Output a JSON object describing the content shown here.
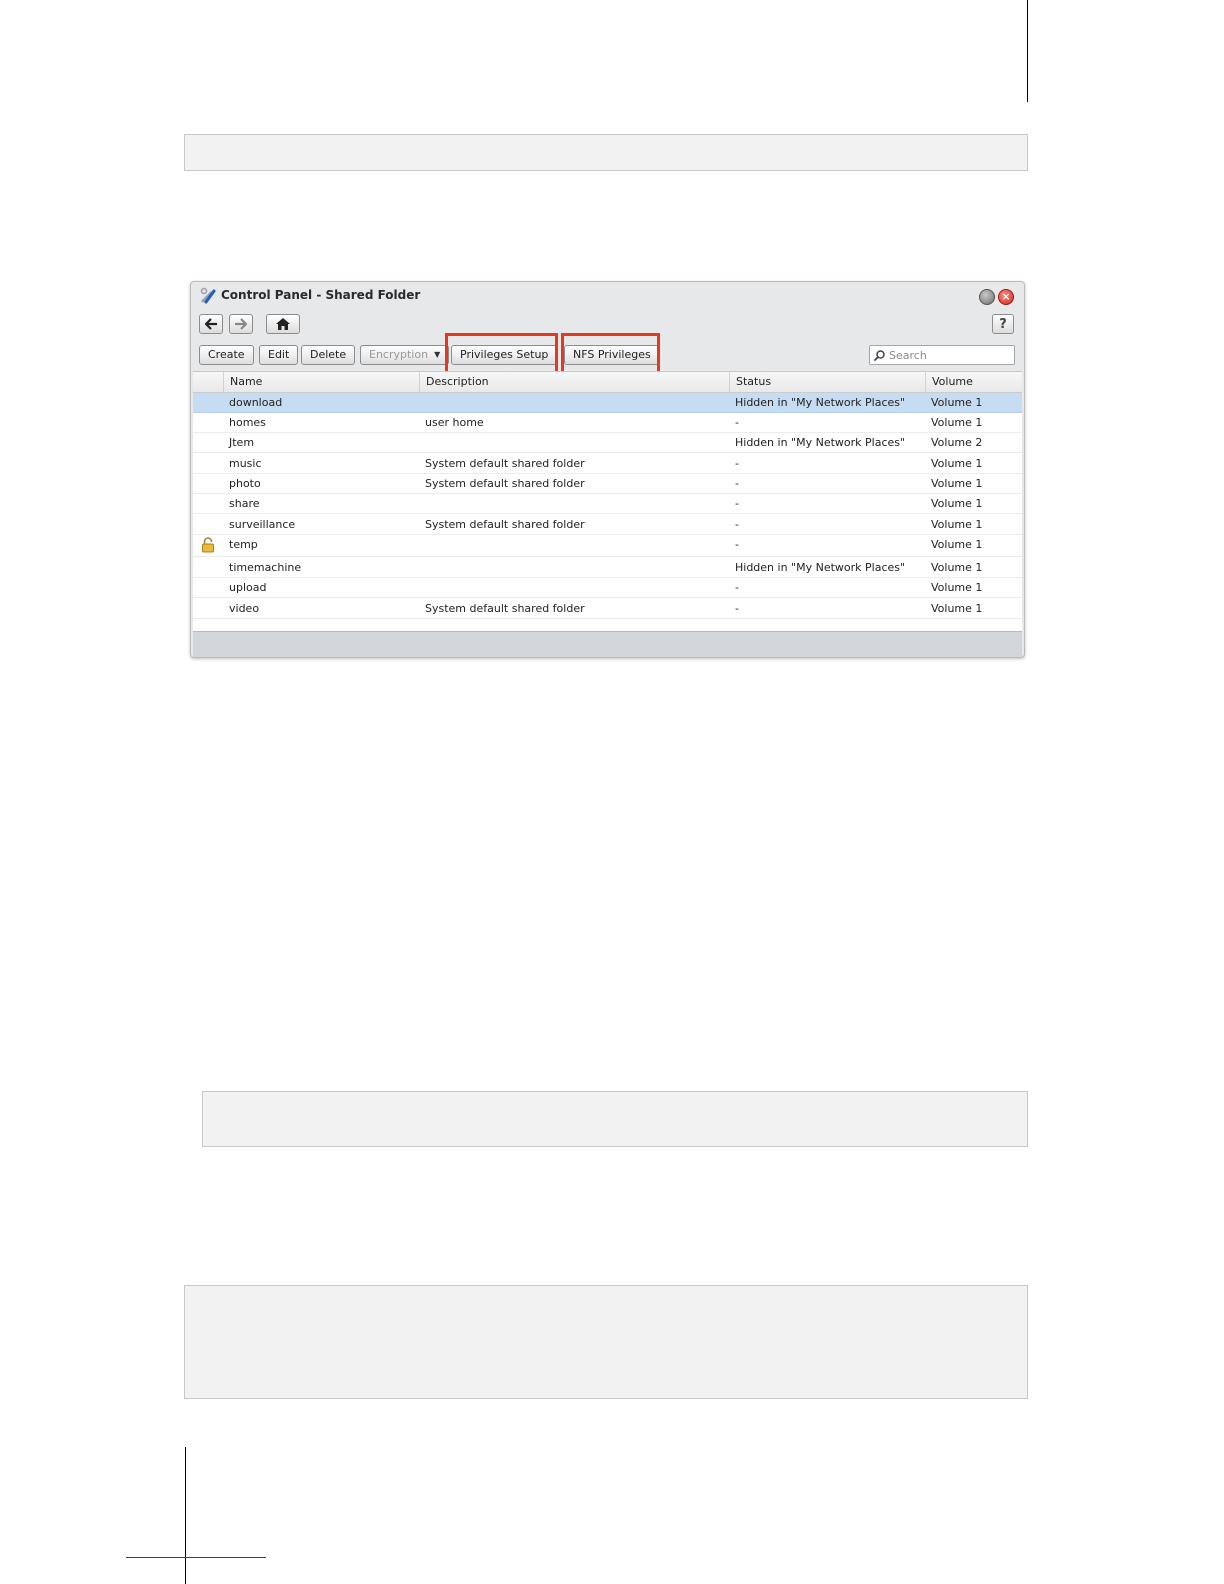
{
  "window": {
    "title": "Control Panel - Shared Folder"
  },
  "toolbar": {
    "create": "Create",
    "edit": "Edit",
    "delete": "Delete",
    "encryption": "Encryption",
    "privileges_setup": "Privileges Setup",
    "nfs_privileges": "NFS Privileges",
    "search_placeholder": "Search"
  },
  "nav": {
    "help": "?"
  },
  "grid": {
    "columns": [
      "Name",
      "Description",
      "Status",
      "Volume"
    ],
    "rows": [
      {
        "name": "download",
        "description": "",
        "status": "Hidden in \"My Network Places\"",
        "volume": "Volume 1",
        "selected": true,
        "locked": false
      },
      {
        "name": "homes",
        "description": "user home",
        "status": "-",
        "volume": "Volume 1",
        "selected": false,
        "locked": false
      },
      {
        "name": "Jtem",
        "description": "",
        "status": "Hidden in \"My Network Places\"",
        "volume": "Volume 2",
        "selected": false,
        "locked": false
      },
      {
        "name": "music",
        "description": "System default shared folder",
        "status": "-",
        "volume": "Volume 1",
        "selected": false,
        "locked": false
      },
      {
        "name": "photo",
        "description": "System default shared folder",
        "status": "-",
        "volume": "Volume 1",
        "selected": false,
        "locked": false
      },
      {
        "name": "share",
        "description": "",
        "status": "-",
        "volume": "Volume 1",
        "selected": false,
        "locked": false
      },
      {
        "name": "surveillance",
        "description": "System default shared folder",
        "status": "-",
        "volume": "Volume 1",
        "selected": false,
        "locked": false
      },
      {
        "name": "temp",
        "description": "",
        "status": "-",
        "volume": "Volume 1",
        "selected": false,
        "locked": true
      },
      {
        "name": "timemachine",
        "description": "",
        "status": "Hidden in \"My Network Places\"",
        "volume": "Volume 1",
        "selected": false,
        "locked": false
      },
      {
        "name": "upload",
        "description": "",
        "status": "-",
        "volume": "Volume 1",
        "selected": false,
        "locked": false
      },
      {
        "name": "video",
        "description": "System default shared folder",
        "status": "-",
        "volume": "Volume 1",
        "selected": false,
        "locked": false
      }
    ]
  },
  "colors": {
    "highlight": "#e3391e",
    "selected_row": "#c6dcf2",
    "close_button": "#d3271e"
  }
}
